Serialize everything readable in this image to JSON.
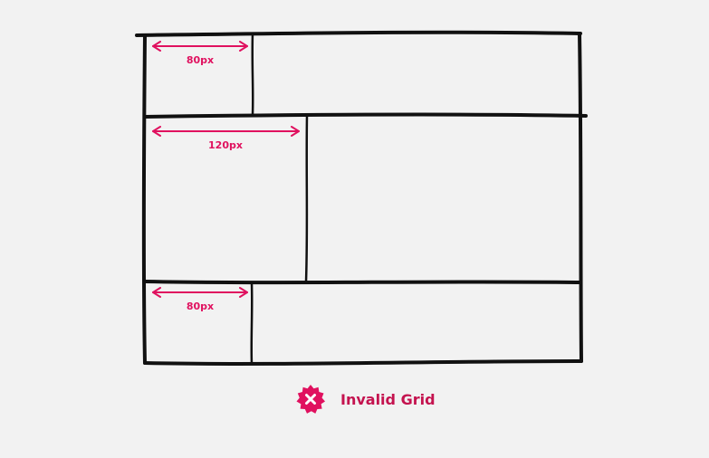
{
  "colors": {
    "background": "#f2f2f2",
    "line": "#111111",
    "accent": "#e0115f",
    "status_text": "#c4134f"
  },
  "rows": [
    {
      "label": "80px"
    },
    {
      "label": "120px"
    },
    {
      "label": "80px"
    }
  ],
  "status": {
    "icon": "x-badge-icon",
    "text": "Invalid Grid"
  }
}
